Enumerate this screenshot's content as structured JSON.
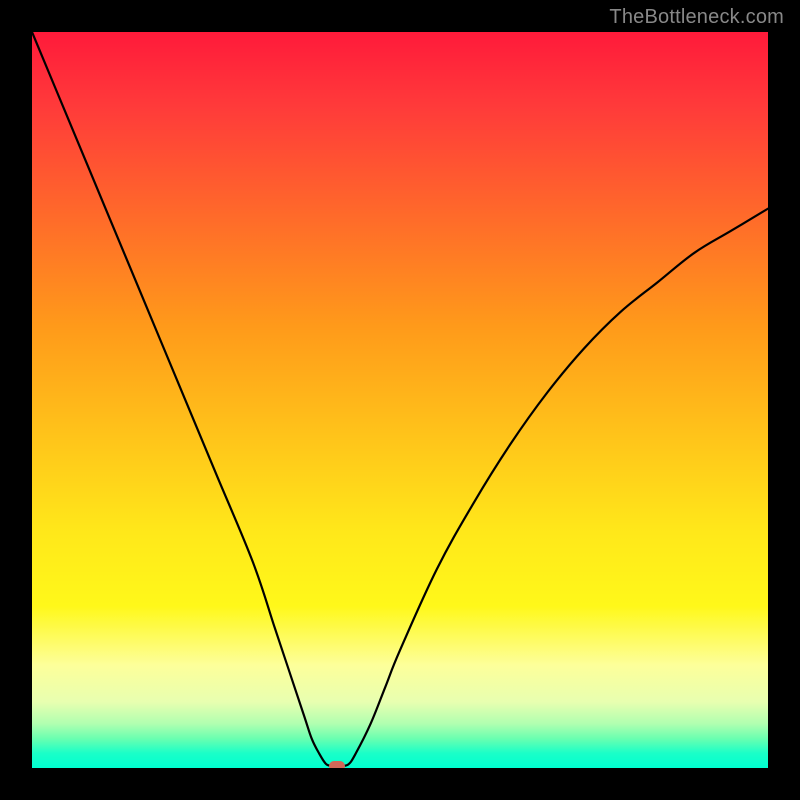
{
  "watermark": "TheBottleneck.com",
  "chart_data": {
    "type": "line",
    "title": "",
    "xlabel": "",
    "ylabel": "",
    "xlim": [
      0,
      100
    ],
    "ylim": [
      0,
      100
    ],
    "grid": false,
    "series": [
      {
        "name": "bottleneck-curve",
        "x": [
          0,
          5,
          10,
          15,
          20,
          25,
          30,
          33,
          35,
          37,
          38,
          39,
          40,
          41,
          42,
          43,
          44,
          46,
          48,
          50,
          55,
          60,
          65,
          70,
          75,
          80,
          85,
          90,
          95,
          100
        ],
        "values": [
          100,
          88,
          76,
          64,
          52,
          40,
          28,
          19,
          13,
          7,
          4,
          2,
          0.5,
          0.3,
          0.3,
          0.5,
          2,
          6,
          11,
          16,
          27,
          36,
          44,
          51,
          57,
          62,
          66,
          70,
          73,
          76
        ]
      }
    ],
    "annotations": [
      {
        "name": "minimum-marker",
        "x": 41.5,
        "y": 0.3
      }
    ],
    "background_gradient": {
      "top": "#ff1a3a",
      "mid": "#ffe81a",
      "bottom": "#00ffd0"
    }
  }
}
